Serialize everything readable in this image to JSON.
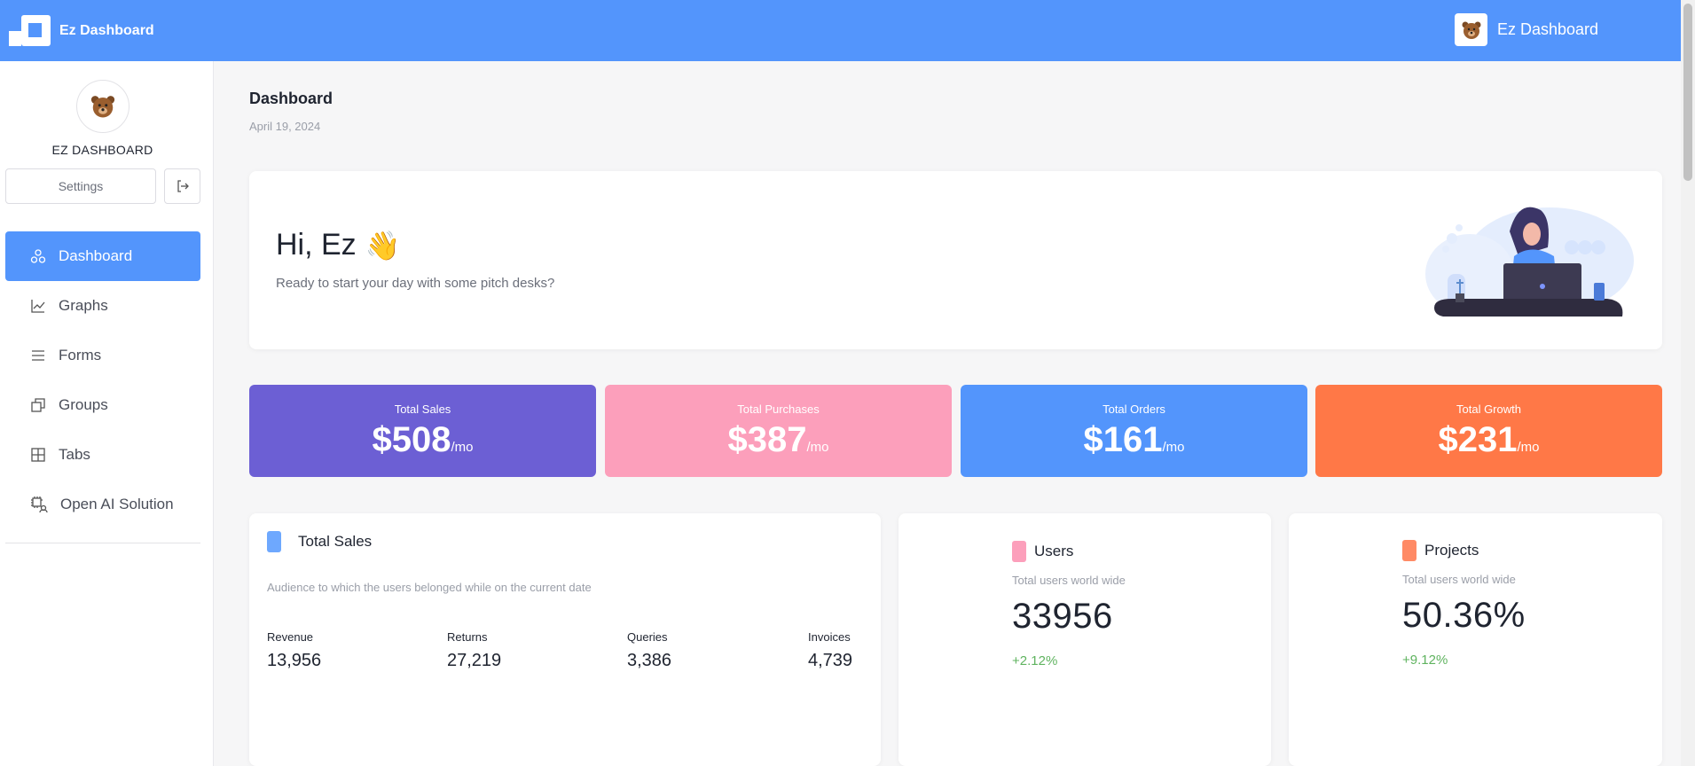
{
  "header": {
    "brand": "Ez Dashboard",
    "user_name": "Ez Dashboard"
  },
  "sidebar": {
    "profile_name": "EZ DASHBOARD",
    "settings_label": "Settings",
    "items": [
      {
        "label": "Dashboard",
        "icon": "dashboard-icon",
        "active": true
      },
      {
        "label": "Graphs",
        "icon": "graph-icon"
      },
      {
        "label": "Forms",
        "icon": "menu-lines-icon"
      },
      {
        "label": "Groups",
        "icon": "groups-icon"
      },
      {
        "label": "Tabs",
        "icon": "grid-icon"
      },
      {
        "label": "Open AI Solution",
        "icon": "ai-icon"
      }
    ]
  },
  "main": {
    "title": "Dashboard",
    "date": "April 19, 2024",
    "welcome": {
      "greeting": "Hi, Ez",
      "emoji": "👋",
      "subtitle": "Ready to start your day with some pitch desks?"
    },
    "stats": [
      {
        "label": "Total Sales",
        "value": "$508",
        "unit": "/mo",
        "color": "#6c5fd4"
      },
      {
        "label": "Total Purchases",
        "value": "$387",
        "unit": "/mo",
        "color": "#fc9fbb"
      },
      {
        "label": "Total Orders",
        "value": "$161",
        "unit": "/mo",
        "color": "#5395fc"
      },
      {
        "label": "Total Growth",
        "value": "$231",
        "unit": "/mo",
        "color": "#ff7847"
      }
    ],
    "sales_card": {
      "title": "Total Sales",
      "subtitle": "Audience to which the users belonged while on the current date",
      "swatch_color": "#6ea8fe",
      "metrics": [
        {
          "label": "Revenue",
          "value": "13,956"
        },
        {
          "label": "Returns",
          "value": "27,219"
        },
        {
          "label": "Queries",
          "value": "3,386"
        },
        {
          "label": "Invoices",
          "value": "4,739"
        }
      ]
    },
    "users_card": {
      "title": "Users",
      "subtitle": "Total users world wide",
      "value": "33956",
      "change": "+2.12%",
      "swatch_color": "#fc9fbb"
    },
    "projects_card": {
      "title": "Projects",
      "subtitle": "Total users world wide",
      "value": "50.36%",
      "change": "+9.12%",
      "swatch_color": "#ff8a65"
    }
  }
}
